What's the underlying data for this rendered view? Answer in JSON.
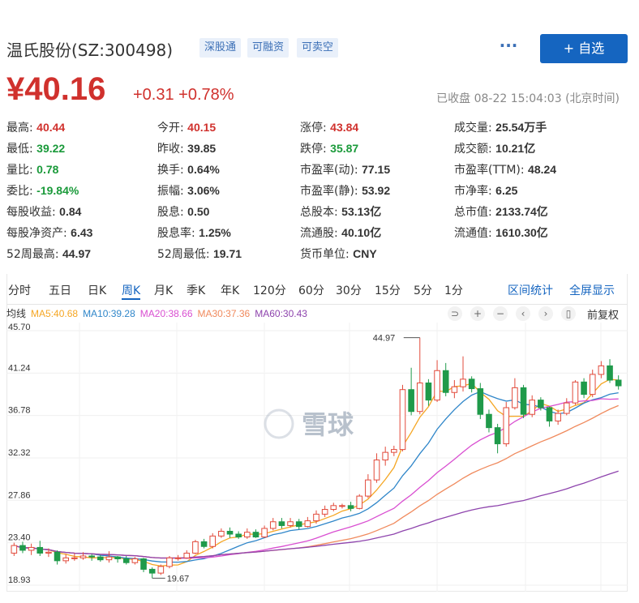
{
  "header": {
    "name": "温氏股份(SZ:300498)",
    "tags": [
      "深股通",
      "可融资",
      "可卖空"
    ],
    "more_label": "···",
    "add_label": "+ 自选"
  },
  "quote": {
    "price": "¥40.16",
    "change": "+0.31",
    "change_pct": "+0.78%",
    "status": "已收盘 08-22 15:04:03 (北京时间)"
  },
  "stats": [
    [
      {
        "label": "最高:",
        "value": "40.44",
        "color": "red"
      },
      {
        "label": "今开:",
        "value": "40.15",
        "color": "red"
      },
      {
        "label": "涨停:",
        "value": "43.84",
        "color": "red"
      },
      {
        "label": "成交量:",
        "value": "25.54万手",
        "color": ""
      }
    ],
    [
      {
        "label": "最低:",
        "value": "39.22",
        "color": "green"
      },
      {
        "label": "昨收:",
        "value": "39.85",
        "color": ""
      },
      {
        "label": "跌停:",
        "value": "35.87",
        "color": "green"
      },
      {
        "label": "成交额:",
        "value": "10.21亿",
        "color": ""
      }
    ],
    [
      {
        "label": "量比:",
        "value": "0.78",
        "color": "green"
      },
      {
        "label": "换手:",
        "value": "0.64%",
        "color": ""
      },
      {
        "label": "市盈率(动):",
        "value": "77.15",
        "color": ""
      },
      {
        "label": "市盈率(TTM):",
        "value": "48.24",
        "color": ""
      }
    ],
    [
      {
        "label": "委比:",
        "value": "-19.84%",
        "color": "green"
      },
      {
        "label": "振幅:",
        "value": "3.06%",
        "color": ""
      },
      {
        "label": "市盈率(静):",
        "value": "53.92",
        "color": ""
      },
      {
        "label": "市净率:",
        "value": "6.25",
        "color": ""
      }
    ],
    [
      {
        "label": "每股收益:",
        "value": "0.84",
        "color": ""
      },
      {
        "label": "股息:",
        "value": "0.50",
        "color": ""
      },
      {
        "label": "总股本:",
        "value": "53.13亿",
        "color": ""
      },
      {
        "label": "总市值:",
        "value": "2133.74亿",
        "color": ""
      }
    ],
    [
      {
        "label": "每股净资产:",
        "value": "6.43",
        "color": ""
      },
      {
        "label": "股息率:",
        "value": "1.25%",
        "color": ""
      },
      {
        "label": "流通股:",
        "value": "40.10亿",
        "color": ""
      },
      {
        "label": "流通值:",
        "value": "1610.30亿",
        "color": ""
      }
    ],
    [
      {
        "label": "52周最高:",
        "value": "44.97",
        "color": ""
      },
      {
        "label": "52周最低:",
        "value": "19.71",
        "color": ""
      },
      {
        "label": "货币单位:",
        "value": "CNY",
        "color": ""
      },
      null
    ]
  ],
  "periods": [
    "分时",
    "五日",
    "日K",
    "周K",
    "月K",
    "季K",
    "年K",
    "120分",
    "60分",
    "30分",
    "15分",
    "5分",
    "1分"
  ],
  "active_period": "周K",
  "period_links": [
    "区间统计",
    "全屏显示"
  ],
  "ma_legend": {
    "label": "均线",
    "items": [
      {
        "text": "MA5:40.68",
        "color": "#f5a623"
      },
      {
        "text": "MA10:39.28",
        "color": "#2f86c9"
      },
      {
        "text": "MA20:38.66",
        "color": "#d94fd1"
      },
      {
        "text": "MA30:37.36",
        "color": "#f08a5d"
      },
      {
        "text": "MA60:30.43",
        "color": "#8e44ad"
      }
    ]
  },
  "tools": [
    "⊃",
    "+",
    "−",
    "‹",
    "›",
    "▯"
  ],
  "adjust_label": "前复权",
  "watermark": "雪球",
  "chart_data": {
    "type": "candlestick",
    "ylim": [
      18.93,
      45.7
    ],
    "y_ticks": [
      "45.70",
      "41.24",
      "36.78",
      "32.32",
      "27.86",
      "23.40",
      "18.93"
    ],
    "annotations": {
      "high": "44.97",
      "low": "19.67"
    },
    "candles": [
      [
        22.3,
        23.1,
        22.0,
        23.4
      ],
      [
        23.1,
        22.6,
        22.3,
        23.5
      ],
      [
        22.6,
        22.9,
        22.1,
        23.3
      ],
      [
        22.9,
        22.3,
        22.0,
        23.6
      ],
      [
        22.3,
        22.4,
        21.9,
        22.8
      ],
      [
        22.4,
        21.5,
        21.1,
        22.6
      ],
      [
        21.5,
        21.8,
        21.2,
        22.2
      ],
      [
        21.8,
        21.8,
        21.5,
        22.3
      ],
      [
        21.8,
        22.0,
        21.6,
        22.4
      ],
      [
        22.0,
        21.9,
        21.5,
        22.2
      ],
      [
        21.9,
        21.6,
        21.4,
        22.1
      ],
      [
        21.6,
        21.9,
        21.3,
        22.5
      ],
      [
        21.9,
        21.7,
        21.3,
        22.0
      ],
      [
        21.7,
        21.3,
        21.1,
        22.0
      ],
      [
        21.3,
        21.7,
        21.1,
        21.9
      ],
      [
        21.7,
        20.6,
        20.3,
        21.8
      ],
      [
        20.6,
        20.2,
        19.67,
        20.8
      ],
      [
        20.2,
        20.9,
        20.0,
        21.1
      ],
      [
        20.9,
        21.8,
        20.7,
        22.0
      ],
      [
        21.8,
        21.8,
        21.5,
        22.1
      ],
      [
        21.8,
        22.3,
        21.7,
        22.6
      ],
      [
        22.3,
        23.5,
        22.2,
        23.7
      ],
      [
        23.5,
        23.0,
        22.8,
        23.8
      ],
      [
        23.0,
        24.1,
        22.8,
        24.4
      ],
      [
        24.1,
        24.6,
        23.9,
        24.9
      ],
      [
        24.6,
        24.3,
        23.9,
        25.0
      ],
      [
        24.3,
        24.0,
        23.8,
        24.6
      ],
      [
        24.0,
        24.5,
        23.8,
        24.9
      ],
      [
        24.5,
        24.0,
        23.9,
        24.8
      ],
      [
        24.0,
        24.9,
        23.9,
        25.2
      ],
      [
        24.9,
        25.6,
        24.7,
        26.0
      ],
      [
        25.6,
        25.2,
        24.9,
        26.0
      ],
      [
        25.2,
        25.6,
        25.0,
        26.0
      ],
      [
        25.6,
        25.1,
        24.8,
        25.9
      ],
      [
        25.1,
        25.7,
        25.0,
        26.1
      ],
      [
        25.7,
        26.4,
        25.4,
        26.8
      ],
      [
        26.4,
        26.9,
        26.1,
        27.3
      ],
      [
        26.9,
        27.3,
        26.7,
        27.6
      ],
      [
        27.3,
        27.3,
        27.0,
        27.5
      ],
      [
        27.3,
        27.0,
        26.7,
        27.7
      ],
      [
        27.0,
        28.3,
        26.9,
        28.5
      ],
      [
        28.3,
        30.0,
        28.1,
        30.6
      ],
      [
        30.0,
        32.1,
        29.7,
        32.8
      ],
      [
        32.1,
        32.9,
        31.5,
        33.5
      ],
      [
        32.9,
        33.2,
        32.5,
        33.6
      ],
      [
        33.2,
        39.5,
        33.0,
        40.0
      ],
      [
        39.5,
        37.2,
        36.8,
        41.8
      ],
      [
        37.2,
        40.2,
        36.9,
        44.97
      ],
      [
        40.2,
        38.4,
        37.8,
        40.6
      ],
      [
        38.4,
        41.5,
        38.2,
        42.6
      ],
      [
        41.5,
        39.2,
        38.8,
        42.3
      ],
      [
        39.2,
        39.8,
        38.6,
        40.5
      ],
      [
        39.8,
        40.6,
        39.3,
        43.0
      ],
      [
        40.6,
        39.6,
        39.2,
        40.9
      ],
      [
        39.6,
        36.9,
        36.4,
        40.2
      ],
      [
        36.9,
        35.5,
        35.0,
        37.4
      ],
      [
        35.5,
        33.8,
        32.8,
        35.9
      ],
      [
        33.8,
        37.6,
        33.5,
        38.2
      ],
      [
        37.6,
        39.7,
        37.4,
        40.7
      ],
      [
        39.7,
        36.9,
        36.5,
        40.0
      ],
      [
        36.9,
        38.4,
        36.6,
        38.9
      ],
      [
        38.4,
        37.6,
        37.3,
        38.7
      ],
      [
        37.6,
        36.2,
        35.6,
        37.7
      ],
      [
        36.2,
        37.0,
        35.8,
        37.4
      ],
      [
        37.0,
        38.1,
        36.8,
        38.6
      ],
      [
        38.1,
        40.3,
        37.9,
        40.5
      ],
      [
        40.3,
        39.0,
        38.6,
        40.7
      ],
      [
        39.0,
        41.1,
        38.7,
        41.6
      ],
      [
        41.1,
        42.0,
        40.7,
        42.5
      ],
      [
        42.0,
        40.5,
        40.2,
        42.7
      ],
      [
        40.5,
        39.9,
        39.5,
        41.0
      ]
    ]
  }
}
